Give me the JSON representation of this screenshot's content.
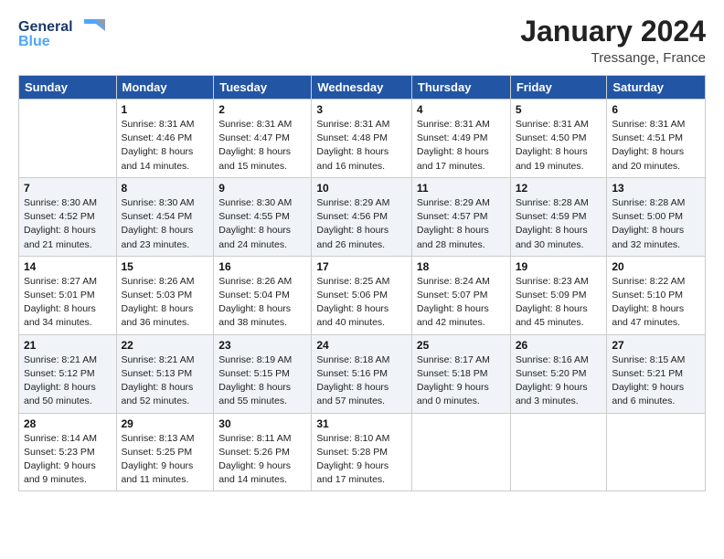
{
  "logo": {
    "general": "General",
    "blue": "Blue"
  },
  "header": {
    "month": "January 2024",
    "location": "Tressange, France"
  },
  "weekdays": [
    "Sunday",
    "Monday",
    "Tuesday",
    "Wednesday",
    "Thursday",
    "Friday",
    "Saturday"
  ],
  "weeks": [
    [
      {
        "day": "",
        "sunrise": "",
        "sunset": "",
        "daylight": ""
      },
      {
        "day": "1",
        "sunrise": "Sunrise: 8:31 AM",
        "sunset": "Sunset: 4:46 PM",
        "daylight": "Daylight: 8 hours and 14 minutes."
      },
      {
        "day": "2",
        "sunrise": "Sunrise: 8:31 AM",
        "sunset": "Sunset: 4:47 PM",
        "daylight": "Daylight: 8 hours and 15 minutes."
      },
      {
        "day": "3",
        "sunrise": "Sunrise: 8:31 AM",
        "sunset": "Sunset: 4:48 PM",
        "daylight": "Daylight: 8 hours and 16 minutes."
      },
      {
        "day": "4",
        "sunrise": "Sunrise: 8:31 AM",
        "sunset": "Sunset: 4:49 PM",
        "daylight": "Daylight: 8 hours and 17 minutes."
      },
      {
        "day": "5",
        "sunrise": "Sunrise: 8:31 AM",
        "sunset": "Sunset: 4:50 PM",
        "daylight": "Daylight: 8 hours and 19 minutes."
      },
      {
        "day": "6",
        "sunrise": "Sunrise: 8:31 AM",
        "sunset": "Sunset: 4:51 PM",
        "daylight": "Daylight: 8 hours and 20 minutes."
      }
    ],
    [
      {
        "day": "7",
        "sunrise": "Sunrise: 8:30 AM",
        "sunset": "Sunset: 4:52 PM",
        "daylight": "Daylight: 8 hours and 21 minutes."
      },
      {
        "day": "8",
        "sunrise": "Sunrise: 8:30 AM",
        "sunset": "Sunset: 4:54 PM",
        "daylight": "Daylight: 8 hours and 23 minutes."
      },
      {
        "day": "9",
        "sunrise": "Sunrise: 8:30 AM",
        "sunset": "Sunset: 4:55 PM",
        "daylight": "Daylight: 8 hours and 24 minutes."
      },
      {
        "day": "10",
        "sunrise": "Sunrise: 8:29 AM",
        "sunset": "Sunset: 4:56 PM",
        "daylight": "Daylight: 8 hours and 26 minutes."
      },
      {
        "day": "11",
        "sunrise": "Sunrise: 8:29 AM",
        "sunset": "Sunset: 4:57 PM",
        "daylight": "Daylight: 8 hours and 28 minutes."
      },
      {
        "day": "12",
        "sunrise": "Sunrise: 8:28 AM",
        "sunset": "Sunset: 4:59 PM",
        "daylight": "Daylight: 8 hours and 30 minutes."
      },
      {
        "day": "13",
        "sunrise": "Sunrise: 8:28 AM",
        "sunset": "Sunset: 5:00 PM",
        "daylight": "Daylight: 8 hours and 32 minutes."
      }
    ],
    [
      {
        "day": "14",
        "sunrise": "Sunrise: 8:27 AM",
        "sunset": "Sunset: 5:01 PM",
        "daylight": "Daylight: 8 hours and 34 minutes."
      },
      {
        "day": "15",
        "sunrise": "Sunrise: 8:26 AM",
        "sunset": "Sunset: 5:03 PM",
        "daylight": "Daylight: 8 hours and 36 minutes."
      },
      {
        "day": "16",
        "sunrise": "Sunrise: 8:26 AM",
        "sunset": "Sunset: 5:04 PM",
        "daylight": "Daylight: 8 hours and 38 minutes."
      },
      {
        "day": "17",
        "sunrise": "Sunrise: 8:25 AM",
        "sunset": "Sunset: 5:06 PM",
        "daylight": "Daylight: 8 hours and 40 minutes."
      },
      {
        "day": "18",
        "sunrise": "Sunrise: 8:24 AM",
        "sunset": "Sunset: 5:07 PM",
        "daylight": "Daylight: 8 hours and 42 minutes."
      },
      {
        "day": "19",
        "sunrise": "Sunrise: 8:23 AM",
        "sunset": "Sunset: 5:09 PM",
        "daylight": "Daylight: 8 hours and 45 minutes."
      },
      {
        "day": "20",
        "sunrise": "Sunrise: 8:22 AM",
        "sunset": "Sunset: 5:10 PM",
        "daylight": "Daylight: 8 hours and 47 minutes."
      }
    ],
    [
      {
        "day": "21",
        "sunrise": "Sunrise: 8:21 AM",
        "sunset": "Sunset: 5:12 PM",
        "daylight": "Daylight: 8 hours and 50 minutes."
      },
      {
        "day": "22",
        "sunrise": "Sunrise: 8:21 AM",
        "sunset": "Sunset: 5:13 PM",
        "daylight": "Daylight: 8 hours and 52 minutes."
      },
      {
        "day": "23",
        "sunrise": "Sunrise: 8:19 AM",
        "sunset": "Sunset: 5:15 PM",
        "daylight": "Daylight: 8 hours and 55 minutes."
      },
      {
        "day": "24",
        "sunrise": "Sunrise: 8:18 AM",
        "sunset": "Sunset: 5:16 PM",
        "daylight": "Daylight: 8 hours and 57 minutes."
      },
      {
        "day": "25",
        "sunrise": "Sunrise: 8:17 AM",
        "sunset": "Sunset: 5:18 PM",
        "daylight": "Daylight: 9 hours and 0 minutes."
      },
      {
        "day": "26",
        "sunrise": "Sunrise: 8:16 AM",
        "sunset": "Sunset: 5:20 PM",
        "daylight": "Daylight: 9 hours and 3 minutes."
      },
      {
        "day": "27",
        "sunrise": "Sunrise: 8:15 AM",
        "sunset": "Sunset: 5:21 PM",
        "daylight": "Daylight: 9 hours and 6 minutes."
      }
    ],
    [
      {
        "day": "28",
        "sunrise": "Sunrise: 8:14 AM",
        "sunset": "Sunset: 5:23 PM",
        "daylight": "Daylight: 9 hours and 9 minutes."
      },
      {
        "day": "29",
        "sunrise": "Sunrise: 8:13 AM",
        "sunset": "Sunset: 5:25 PM",
        "daylight": "Daylight: 9 hours and 11 minutes."
      },
      {
        "day": "30",
        "sunrise": "Sunrise: 8:11 AM",
        "sunset": "Sunset: 5:26 PM",
        "daylight": "Daylight: 9 hours and 14 minutes."
      },
      {
        "day": "31",
        "sunrise": "Sunrise: 8:10 AM",
        "sunset": "Sunset: 5:28 PM",
        "daylight": "Daylight: 9 hours and 17 minutes."
      },
      {
        "day": "",
        "sunrise": "",
        "sunset": "",
        "daylight": ""
      },
      {
        "day": "",
        "sunrise": "",
        "sunset": "",
        "daylight": ""
      },
      {
        "day": "",
        "sunrise": "",
        "sunset": "",
        "daylight": ""
      }
    ]
  ]
}
